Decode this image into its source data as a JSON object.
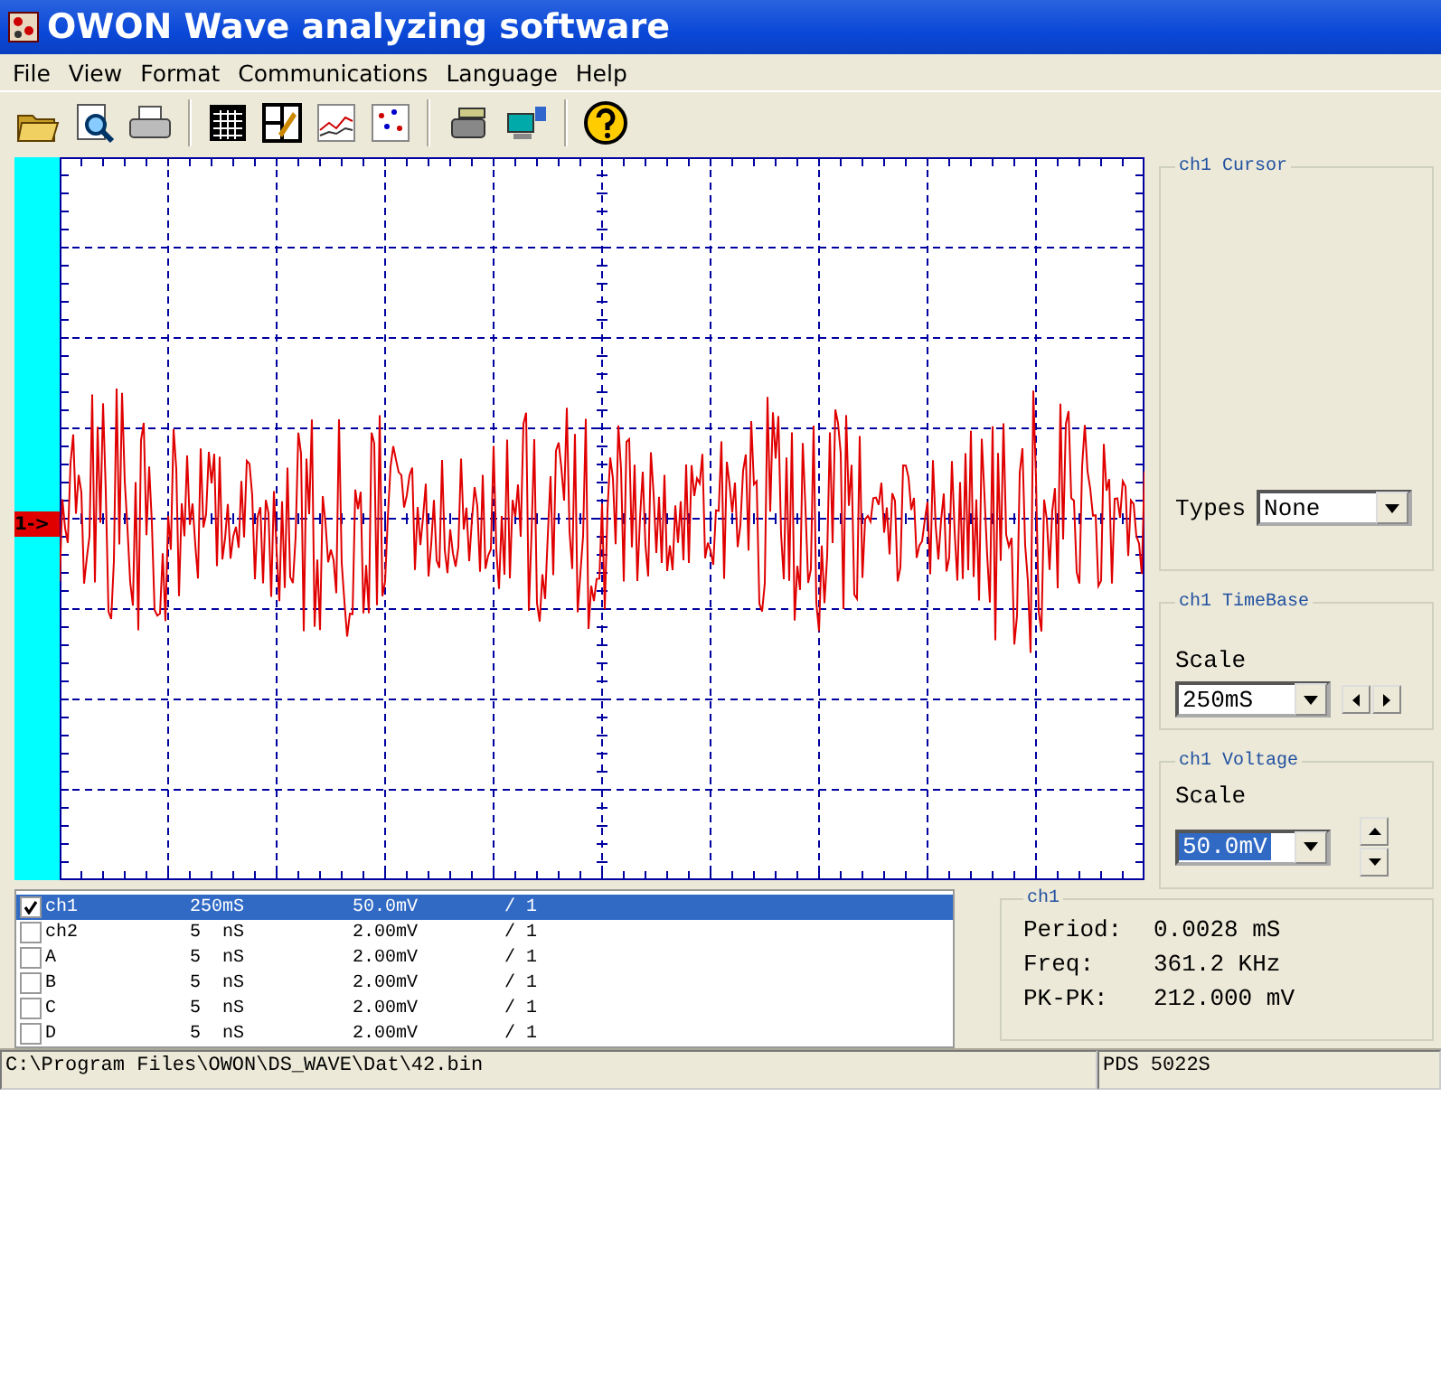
{
  "window": {
    "title": "OWON Wave analyzing software"
  },
  "menu": [
    "File",
    "View",
    "Format",
    "Communications",
    "Language",
    "Help"
  ],
  "scope": {
    "channel_marker": "1->"
  },
  "cursor_panel": {
    "title": "ch1 Cursor",
    "types_label": "Types",
    "types_value": "None"
  },
  "timebase_panel": {
    "title": "ch1 TimeBase",
    "scale_label": "Scale",
    "scale_value": "250mS"
  },
  "voltage_panel": {
    "title": "ch1 Voltage",
    "scale_label": "Scale",
    "scale_value": "50.0mV",
    "value_selected": true
  },
  "channels": [
    {
      "name": "ch1",
      "timebase": "250mS",
      "voltage": "50.0mV",
      "ratio": "/ 1",
      "checked": true,
      "selected": true
    },
    {
      "name": "ch2",
      "timebase": "5  nS",
      "voltage": "2.00mV",
      "ratio": "/ 1",
      "checked": false,
      "selected": false
    },
    {
      "name": "A",
      "timebase": "5  nS",
      "voltage": "2.00mV",
      "ratio": "/ 1",
      "checked": false,
      "selected": false
    },
    {
      "name": "B",
      "timebase": "5  nS",
      "voltage": "2.00mV",
      "ratio": "/ 1",
      "checked": false,
      "selected": false
    },
    {
      "name": "C",
      "timebase": "5  nS",
      "voltage": "2.00mV",
      "ratio": "/ 1",
      "checked": false,
      "selected": false
    },
    {
      "name": "D",
      "timebase": "5  nS",
      "voltage": "2.00mV",
      "ratio": "/ 1",
      "checked": false,
      "selected": false
    }
  ],
  "measurements": {
    "title": "ch1",
    "rows": [
      {
        "label": "Period:",
        "value": "0.0028 mS"
      },
      {
        "label": "Freq:",
        "value": "361.2 KHz"
      },
      {
        "label": "PK-PK:",
        "value": "212.000 mV"
      }
    ]
  },
  "status_bar": {
    "path": "C:\\Program Files\\OWON\\DS_WAVE\\Dat\\42.bin",
    "model": "PDS 5022S"
  }
}
